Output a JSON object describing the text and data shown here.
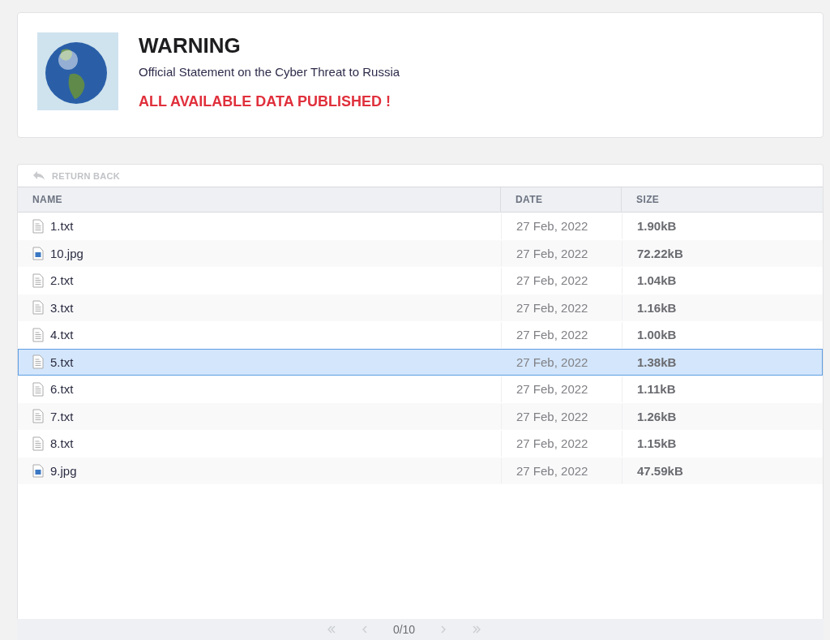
{
  "header": {
    "title": "WARNING",
    "subtitle": "Official Statement on the Cyber Threat to Russia",
    "alert": "ALL AVAILABLE DATA PUBLISHED !"
  },
  "toolbar": {
    "back_label": "RETURN BACK"
  },
  "table": {
    "columns": [
      "NAME",
      "DATE",
      "SIZE"
    ],
    "rows": [
      {
        "name": "1.txt",
        "kind": "text",
        "date": "27 Feb, 2022",
        "size": "1.90kB",
        "selected": false
      },
      {
        "name": "10.jpg",
        "kind": "image",
        "date": "27 Feb, 2022",
        "size": "72.22kB",
        "selected": false
      },
      {
        "name": "2.txt",
        "kind": "text",
        "date": "27 Feb, 2022",
        "size": "1.04kB",
        "selected": false
      },
      {
        "name": "3.txt",
        "kind": "text",
        "date": "27 Feb, 2022",
        "size": "1.16kB",
        "selected": false
      },
      {
        "name": "4.txt",
        "kind": "text",
        "date": "27 Feb, 2022",
        "size": "1.00kB",
        "selected": false
      },
      {
        "name": "5.txt",
        "kind": "text",
        "date": "27 Feb, 2022",
        "size": "1.38kB",
        "selected": true
      },
      {
        "name": "6.txt",
        "kind": "text",
        "date": "27 Feb, 2022",
        "size": "1.11kB",
        "selected": false
      },
      {
        "name": "7.txt",
        "kind": "text",
        "date": "27 Feb, 2022",
        "size": "1.26kB",
        "selected": false
      },
      {
        "name": "8.txt",
        "kind": "text",
        "date": "27 Feb, 2022",
        "size": "1.15kB",
        "selected": false
      },
      {
        "name": "9.jpg",
        "kind": "image",
        "date": "27 Feb, 2022",
        "size": "47.59kB",
        "selected": false
      }
    ]
  },
  "pagination": {
    "page": "0/10"
  }
}
